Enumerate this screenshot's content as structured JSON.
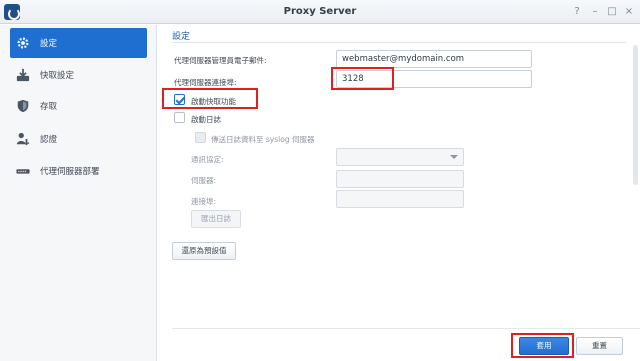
{
  "window": {
    "title": "Proxy Server",
    "help": "?",
    "minimize": "–",
    "maximize": "□",
    "close": "×"
  },
  "sidebar": {
    "items": [
      {
        "label": "設定",
        "icon": "gear-icon",
        "active": true
      },
      {
        "label": "快取設定",
        "icon": "download-icon"
      },
      {
        "label": "存取",
        "icon": "shield-icon"
      },
      {
        "label": "認證",
        "icon": "user-key-icon"
      },
      {
        "label": "代理伺服器部署",
        "icon": "network-device-icon"
      }
    ]
  },
  "main": {
    "section_title": "設定",
    "admin_email_label": "代理伺服器管理員電子郵件:",
    "admin_email_value": "webmaster@mydomain.com",
    "port_label": "代理伺服器連接埠:",
    "port_value": "3128",
    "enable_cache_label": "啟動快取功能",
    "enable_cache_checked": true,
    "enable_log_label": "啟動日誌",
    "enable_log_checked": false,
    "syslog_label": "傳送日誌資料至 syslog 伺服器",
    "protocol_label": "通訊協定:",
    "protocol_value": "",
    "server_label": "伺服器:",
    "server_value": "",
    "port2_label": "連接埠:",
    "port2_value": "",
    "export_log_button": "匯出日誌",
    "restore_defaults_button": "還原為預設值"
  },
  "footer": {
    "apply_button": "套用",
    "reset_button": "重置"
  },
  "colors": {
    "accent": "#1f6fd1",
    "highlight": "#e02020"
  }
}
